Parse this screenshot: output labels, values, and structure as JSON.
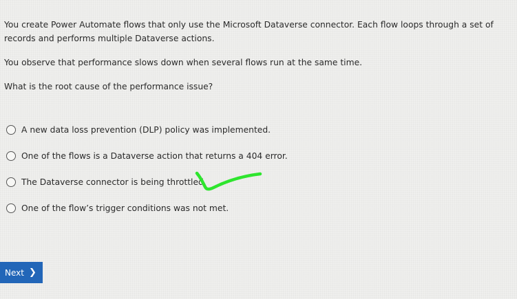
{
  "question": {
    "paragraph1": "You create Power Automate flows that only use the Microsoft Dataverse connector. Each flow loops through a set of records and performs multiple Dataverse actions.",
    "paragraph2": "You observe that performance slows down when several flows run at the same time.",
    "prompt": "What is the root cause of the performance issue?"
  },
  "options": [
    {
      "label": "A new data loss prevention (DLP) policy was implemented."
    },
    {
      "label": "One of the flows is a Dataverse action that returns a 404 error."
    },
    {
      "label": "The Dataverse connector is being throttled."
    },
    {
      "label": "One of the flow’s trigger conditions was not met."
    }
  ],
  "navigation": {
    "next_label": "Next"
  },
  "icons": {
    "next_chevron": "chevron-right-icon",
    "annotation": "checkmark-annotation-icon"
  },
  "colors": {
    "next_button": "#2266b8",
    "annotation": "#2ee52e"
  }
}
